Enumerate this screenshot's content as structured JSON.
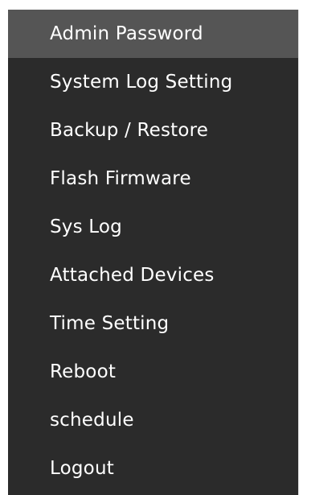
{
  "menu": {
    "items": [
      {
        "label": "Admin Password",
        "active": true
      },
      {
        "label": "System Log Setting",
        "active": false
      },
      {
        "label": "Backup / Restore",
        "active": false
      },
      {
        "label": "Flash Firmware",
        "active": false
      },
      {
        "label": "Sys Log",
        "active": false
      },
      {
        "label": "Attached Devices",
        "active": false
      },
      {
        "label": "Time Setting",
        "active": false
      },
      {
        "label": "Reboot",
        "active": false
      },
      {
        "label": "schedule",
        "active": false
      },
      {
        "label": "Logout",
        "active": false
      }
    ]
  },
  "colors": {
    "menu_background": "#2b2b2b",
    "active_item_background": "#555555",
    "text": "#ffffff",
    "page_background": "#ffffff"
  }
}
